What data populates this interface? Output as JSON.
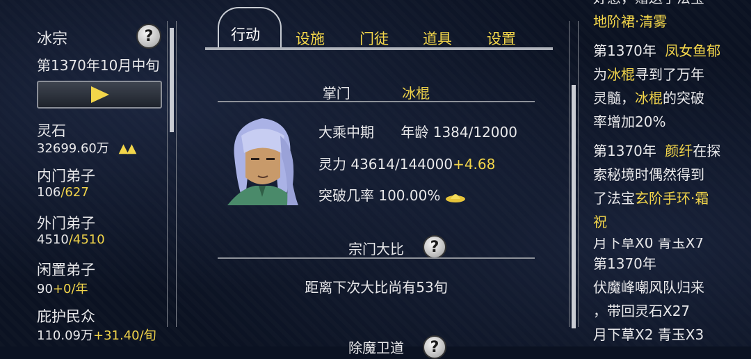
{
  "left": {
    "sect_name": "冰宗",
    "date": "第1370年10月中旬",
    "stats": [
      {
        "label": "灵石",
        "value": "32699.60万",
        "extra": "▲▲"
      },
      {
        "label": "内门弟子",
        "value": "106",
        "extra": "/627"
      },
      {
        "label": "外门弟子",
        "value": "4510",
        "extra": "/4510"
      },
      {
        "label": "闲置弟子",
        "value": "90",
        "extra": "+0/年"
      },
      {
        "label": "庇护民众",
        "value": "110.09万",
        "extra": "+31.40/旬"
      }
    ]
  },
  "tabs": {
    "items": [
      "行动",
      "设施",
      "门徒",
      "道具",
      "设置"
    ]
  },
  "leader": {
    "title": "掌门",
    "name": "冰棍",
    "realm": "大乘中期",
    "age_label": "年龄",
    "age_value": "1384/12000",
    "power_label": "灵力",
    "power_value": "43614/144000",
    "power_rate": "+4.68",
    "break_label": "突破几率",
    "break_value": "100.00%"
  },
  "contest": {
    "title": "宗门大比",
    "text": "距离下次大比尚有53旬"
  },
  "next_section": {
    "title": "除魔卫道"
  },
  "log": {
    "top_partial": "好感，赠送了法宝",
    "top_item": "地阶裙·清雾",
    "e1_year": "第1370年",
    "e1_name1": "凤女鱼郁",
    "e1_l2a": "为",
    "e1_name2": "冰棍",
    "e1_l2b": "寻到了万年",
    "e1_l3a": "灵髓，",
    "e1_name3": "冰棍",
    "e1_l3b": "的突破",
    "e1_l4": "率增加20%",
    "e2_year": "第1370年",
    "e2_name": "颜纤",
    "e2_l1b": "在探",
    "e2_l2": "索秘境时偶然得到",
    "e2_l3a": "了法宝",
    "e2_item1": "玄阶手环·霜",
    "e2_item2": "祝",
    "e3_partial": "月下草X0 青玉X7",
    "e3_year": "第1370年",
    "e3_l2": "伏魔峰嘲风队归来",
    "e3_l3": "，带回灵石X27",
    "e3_l4": "月下草X2 青玉X3"
  }
}
